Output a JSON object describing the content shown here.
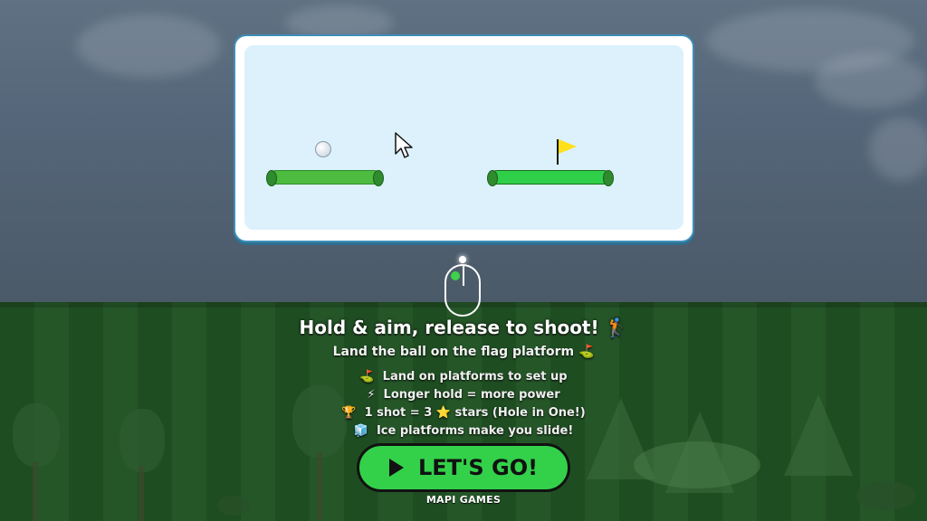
{
  "tutorial": {
    "title": "Hold & aim, release to shoot! 🏌",
    "subtitle": "Land the ball on the flag platform ⛳",
    "tips": [
      {
        "icon": "⛳",
        "text": "Land on platforms to set up"
      },
      {
        "icon": "⚡",
        "text": "Longer hold = more power"
      },
      {
        "icon": "🏆",
        "text": "1 shot = 3 ⭐ stars (Hole in One!)"
      },
      {
        "icon": "🧊",
        "text": "Ice platforms make you slide!"
      }
    ]
  },
  "start_button": {
    "label": "LET'S GO!"
  },
  "brand": "MAPI GAMES",
  "colors": {
    "button": "#33d14a",
    "flag": "#ffe01a",
    "platform": "#4cbb3f",
    "panel_bg": "#dcf1fb"
  }
}
